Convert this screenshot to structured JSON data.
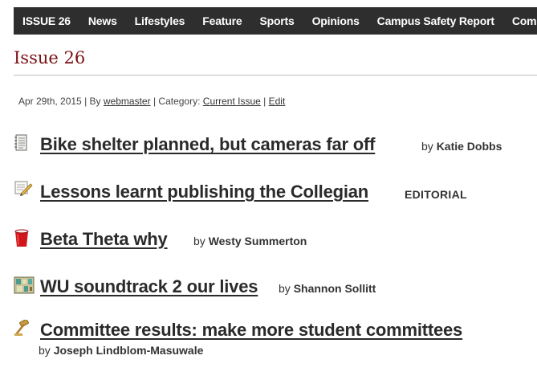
{
  "nav": {
    "items": [
      "ISSUE 26",
      "News",
      "Lifestyles",
      "Feature",
      "Sports",
      "Opinions",
      "Campus Safety Report",
      "Comics"
    ]
  },
  "page": {
    "title": "Issue 26"
  },
  "meta": {
    "date": "Apr 29th, 2015",
    "by_prefix": "By",
    "author": "webmaster",
    "category_prefix": "Category:",
    "category": "Current Issue",
    "separator": "|",
    "edit": "Edit"
  },
  "articles": [
    {
      "icon": "document-icon",
      "title": "Bike shelter planned, but cameras far off",
      "by": "by",
      "author": "Katie Dobbs"
    },
    {
      "icon": "pencil-paper-icon",
      "title": "Lessons learnt publishing the Collegian",
      "label": "EDITORIAL"
    },
    {
      "icon": "red-cup-icon",
      "title": "Beta Theta why",
      "by": "by",
      "author": "Westy Summerton"
    },
    {
      "icon": "map-icon",
      "title": "WU soundtrack 2 our lives",
      "by": "by",
      "author": "Shannon Sollitt"
    },
    {
      "icon": "gavel-icon",
      "title": "Committee results: make more student committees",
      "by": "by",
      "author": "Joseph Lindblom-Masuwale"
    }
  ]
}
